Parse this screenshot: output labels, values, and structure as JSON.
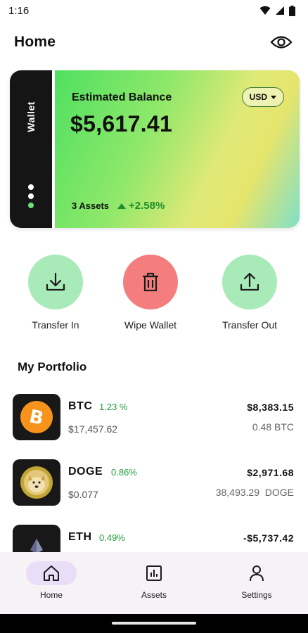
{
  "status_bar": {
    "time": "1:16"
  },
  "header": {
    "title": "Home"
  },
  "wallet_card": {
    "tab_label": "Wallet",
    "balance_label": "Estimated Balance",
    "balance_value": "$5,617.41",
    "currency": "USD",
    "assets_count": "3 Assets",
    "change": "+2.58%",
    "colors": {
      "change_green": "#1a8d2c",
      "tab_bg": "#151515"
    }
  },
  "actions": [
    {
      "label": "Transfer In",
      "icon": "download-icon",
      "color": "#a8eab8"
    },
    {
      "label": "Wipe Wallet",
      "icon": "trash-icon",
      "color": "#f47e7e"
    },
    {
      "label": "Transfer Out",
      "icon": "upload-icon",
      "color": "#a8eab8"
    }
  ],
  "portfolio": {
    "title": "My Portfolio",
    "items": [
      {
        "symbol": "BTC",
        "change": "1.23 %",
        "price": "$17,457.62",
        "value": "$8,383.15",
        "holding": "0.48 BTC",
        "icon": "bitcoin-icon"
      },
      {
        "symbol": "DOGE",
        "change": "0.86%",
        "price": "$0.077",
        "value": "$2,971.68",
        "holding": "38,493.29  DOGE",
        "icon": "dogecoin-icon"
      },
      {
        "symbol": "ETH",
        "change": "0.49%",
        "value": "-$5,737.42",
        "icon": "ethereum-icon"
      }
    ]
  },
  "bottom_nav": [
    {
      "label": "Home",
      "icon": "home-icon",
      "active": true
    },
    {
      "label": "Assets",
      "icon": "chart-icon",
      "active": false
    },
    {
      "label": "Settings",
      "icon": "person-icon",
      "active": false
    }
  ]
}
